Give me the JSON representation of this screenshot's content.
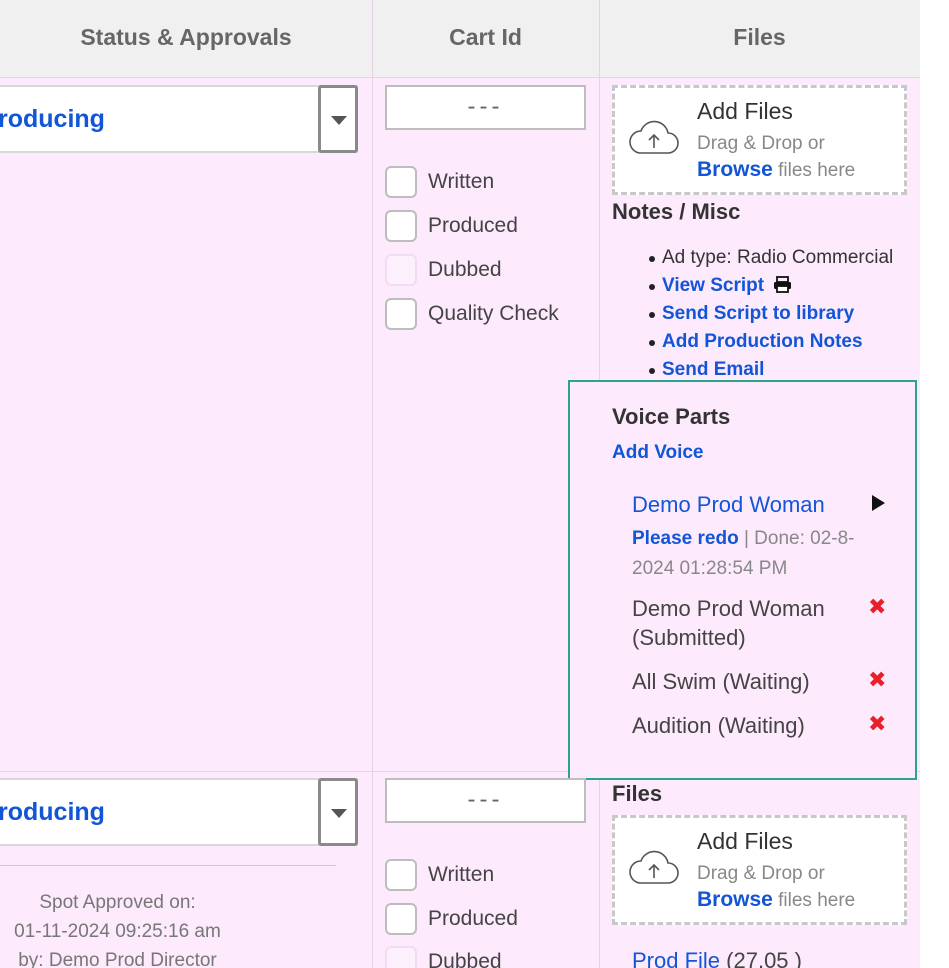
{
  "header": {
    "col_status": "Status & Approvals",
    "col_cart": "Cart Id",
    "col_files": "Files"
  },
  "rows": [
    {
      "status_value": "roducing",
      "cart_id": "---",
      "checks": [
        {
          "label": "Written",
          "checked": false
        },
        {
          "label": "Produced",
          "checked": false
        },
        {
          "label": "Dubbed",
          "checked": false
        },
        {
          "label": "Quality Check",
          "checked": false
        }
      ],
      "dropzone": {
        "title": "Add Files",
        "line1": "Drag & Drop or",
        "browse": "Browse",
        "line2_rest": " files here"
      },
      "notes_title": "Notes / Misc",
      "notes": {
        "ad_type": "Ad type: Radio Commercial",
        "view_script": "View Script",
        "send_script": "Send Script to library",
        "add_notes": "Add Production Notes",
        "send_email": "Send Email"
      },
      "voice_parts": {
        "title": "Voice Parts",
        "add_voice": "Add Voice",
        "active_name": "Demo Prod Woman",
        "redo": "Please redo",
        "done_text": " | Done: 02-8-2024 01:28:54 PM",
        "items": [
          {
            "line1": "Demo Prod Woman",
            "line2": "(Submitted)"
          },
          {
            "line1": "All Swim (Waiting)"
          },
          {
            "line1": "Audition (Waiting)"
          }
        ]
      }
    },
    {
      "status_value": "roducing",
      "cart_id": "---",
      "checks": [
        {
          "label": "Written",
          "checked": false
        },
        {
          "label": "Produced",
          "checked": false
        },
        {
          "label": "Dubbed",
          "checked": false
        }
      ],
      "approved": {
        "line1": "Spot Approved on:",
        "line2": "01-11-2024 09:25:16 am",
        "line3": "by: Demo Prod Director"
      },
      "files_title": "Files",
      "dropzone": {
        "title": "Add Files",
        "line1": "Drag & Drop or",
        "browse": "Browse",
        "line2_rest": " files here"
      },
      "prod_file": {
        "name": "Prod File",
        "size": " (27.05 )"
      }
    }
  ],
  "colors": {
    "link": "#1255d6",
    "row_bg": "#fdeafd",
    "accent_border": "#2aa58c",
    "delete": "#e8202a"
  }
}
